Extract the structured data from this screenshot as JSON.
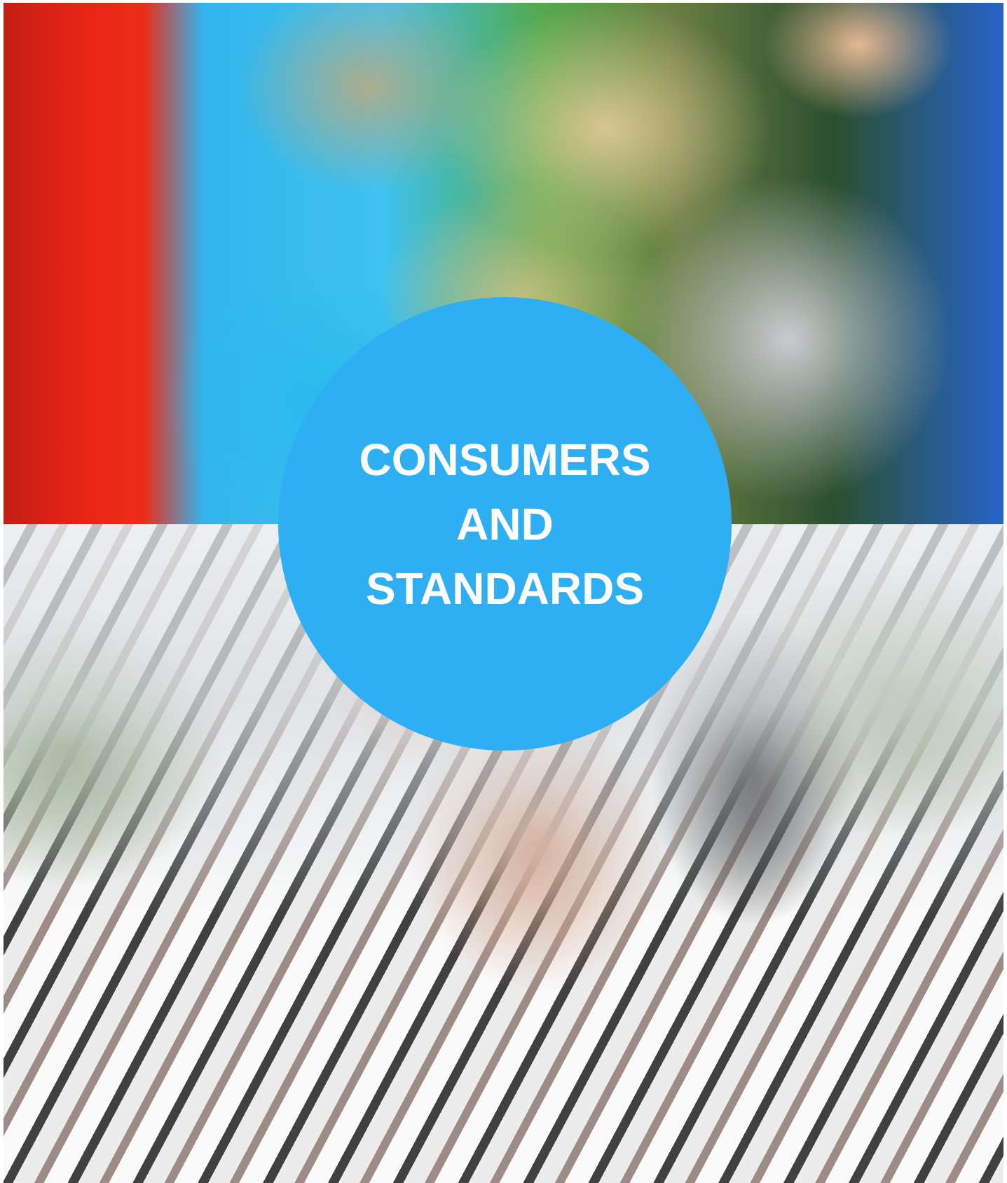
{
  "badge": {
    "lines": [
      "CONSUMERS",
      "AND",
      "STANDARDS"
    ],
    "color": "#2faff3",
    "text_color": "#ffffff"
  },
  "images": {
    "top": {
      "icon": "child-photo"
    },
    "bottom": {
      "icon": "woman-on-phone-photo"
    }
  }
}
